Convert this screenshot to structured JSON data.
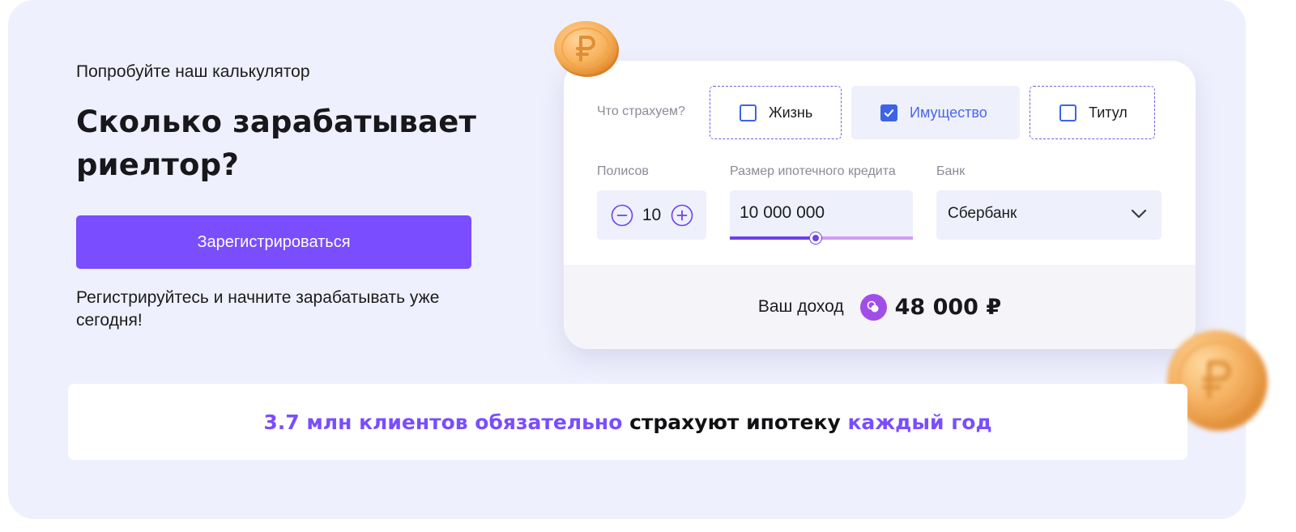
{
  "promo": {
    "eyebrow": "Попробуйте наш калькулятор",
    "title": "Сколько зарабатывает риелтор?",
    "register_label": "Зарегистрироваться",
    "note": "Регистрируйтесь и начните зарабатывать уже сегодня!"
  },
  "calculator": {
    "insure_label": "Что страхуем?",
    "options": [
      {
        "label": "Жизнь",
        "checked": false
      },
      {
        "label": "Имущество",
        "checked": true
      },
      {
        "label": "Титул",
        "checked": false
      }
    ],
    "policies_label": "Полисов",
    "policies_value": "10",
    "loan_label": "Размер ипотечного кредита",
    "loan_value": "10 000 000",
    "loan_slider_fraction": 0.47,
    "bank_label": "Банк",
    "bank_value": "Сбербанк",
    "income_label": "Ваш доход",
    "income_value": "48 000 ₽"
  },
  "stat": {
    "part1": "3.7 млн клиентов обязательно",
    "part2": " страхуют ипотеку ",
    "part3": "каждый год"
  },
  "icons": {
    "checkbox": "checkbox-icon",
    "minus": "minus-circle-icon",
    "plus": "plus-circle-icon",
    "chevron": "chevron-down-icon",
    "income": "coins-icon",
    "coin": "ruble-coin-icon"
  },
  "colors": {
    "accent": "#7a4dff",
    "checkbox": "#3d64e6",
    "panel_bg": "#eff0fd",
    "income_icon": "#a14ee9"
  }
}
